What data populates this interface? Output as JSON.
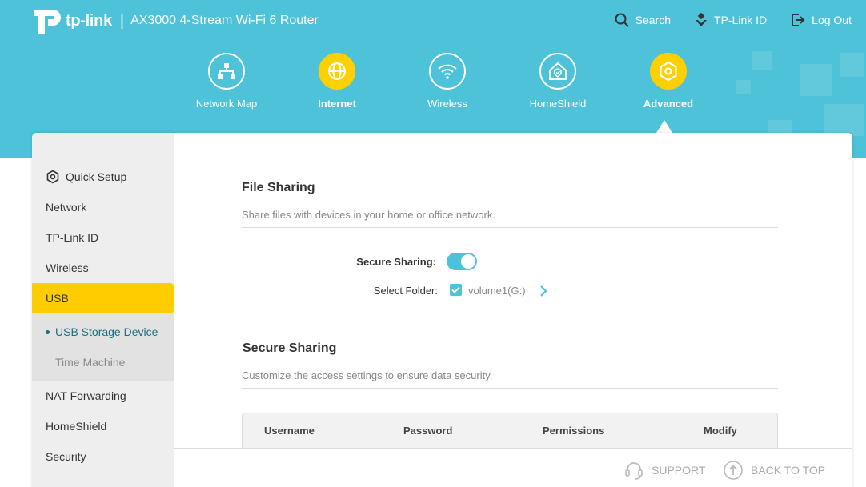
{
  "brand": {
    "logo_text": "tp-link",
    "separator": "|",
    "model": "AX3000 4-Stream Wi-Fi 6 Router"
  },
  "top_links": {
    "search": "Search",
    "tplink_id": "TP-Link ID",
    "logout": "Log Out"
  },
  "main_nav": [
    {
      "label": "Network Map",
      "icon": "network-map-icon"
    },
    {
      "label": "Internet",
      "icon": "globe-icon"
    },
    {
      "label": "Wireless",
      "icon": "wifi-icon"
    },
    {
      "label": "HomeShield",
      "icon": "homeshield-icon"
    },
    {
      "label": "Advanced",
      "icon": "gear-icon",
      "active": true
    }
  ],
  "sidebar": {
    "items": [
      "Quick Setup",
      "Network",
      "TP-Link ID",
      "Wireless",
      "USB"
    ],
    "usb_sub": [
      "USB Storage Device",
      "Time Machine"
    ],
    "items_after": [
      "NAT Forwarding",
      "HomeShield",
      "Security"
    ]
  },
  "file_sharing": {
    "title": "File Sharing",
    "desc": "Share files with devices in your home or office network.",
    "secure_sharing_label": "Secure Sharing:",
    "select_folder_label": "Select Folder:",
    "folder_name": "volume1(G:)"
  },
  "secure_sharing": {
    "title": "Secure Sharing",
    "desc": "Customize the access settings to ensure data security.",
    "columns": [
      "Username",
      "Password",
      "Permissions",
      "Modify"
    ]
  },
  "footer": {
    "support": "SUPPORT",
    "back_to_top": "BACK TO TOP"
  },
  "colors": {
    "header": "#4dc2d8",
    "accent": "#ffd000",
    "active_sidebar": "#ffcc00"
  }
}
